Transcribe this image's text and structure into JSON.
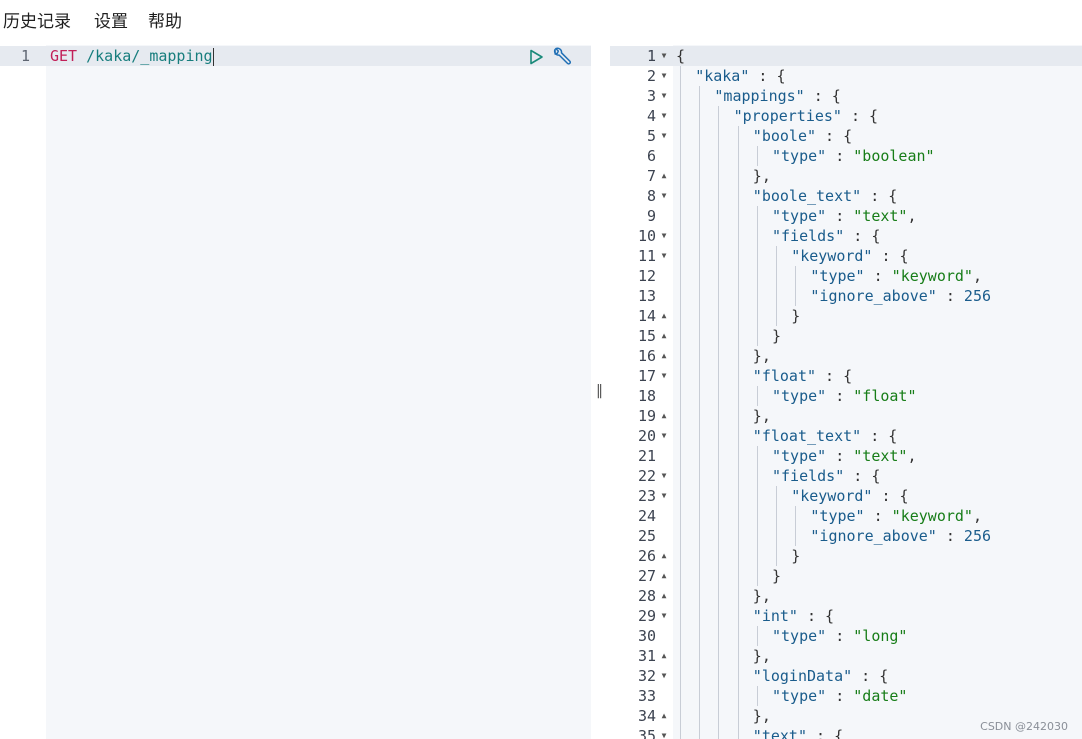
{
  "menu": {
    "history": "历史记录",
    "settings": "设置",
    "help": "帮助"
  },
  "request": {
    "line_number": "1",
    "method": "GET",
    "path": "/kaka/_mapping"
  },
  "icons": {
    "run": "play-icon",
    "settings": "wrench-icon",
    "divider": "resize-handle-icon"
  },
  "divider_label": "‖",
  "response_lines": [
    {
      "n": "1",
      "fold": "down",
      "indent": 0,
      "tokens": [
        [
          "p",
          "{"
        ]
      ]
    },
    {
      "n": "2",
      "fold": "down",
      "indent": 1,
      "tokens": [
        [
          "k",
          "\"kaka\""
        ],
        [
          "p",
          " : {"
        ]
      ]
    },
    {
      "n": "3",
      "fold": "down",
      "indent": 2,
      "tokens": [
        [
          "k",
          "\"mappings\""
        ],
        [
          "p",
          " : {"
        ]
      ]
    },
    {
      "n": "4",
      "fold": "down",
      "indent": 3,
      "tokens": [
        [
          "k",
          "\"properties\""
        ],
        [
          "p",
          " : {"
        ]
      ]
    },
    {
      "n": "5",
      "fold": "down",
      "indent": 4,
      "tokens": [
        [
          "k",
          "\"boole\""
        ],
        [
          "p",
          " : {"
        ]
      ]
    },
    {
      "n": "6",
      "fold": "",
      "indent": 5,
      "tokens": [
        [
          "k",
          "\"type\""
        ],
        [
          "p",
          " : "
        ],
        [
          "s",
          "\"boolean\""
        ]
      ]
    },
    {
      "n": "7",
      "fold": "up",
      "indent": 4,
      "tokens": [
        [
          "p",
          "},"
        ]
      ]
    },
    {
      "n": "8",
      "fold": "down",
      "indent": 4,
      "tokens": [
        [
          "k",
          "\"boole_text\""
        ],
        [
          "p",
          " : {"
        ]
      ]
    },
    {
      "n": "9",
      "fold": "",
      "indent": 5,
      "tokens": [
        [
          "k",
          "\"type\""
        ],
        [
          "p",
          " : "
        ],
        [
          "s",
          "\"text\""
        ],
        [
          "p",
          ","
        ]
      ]
    },
    {
      "n": "10",
      "fold": "down",
      "indent": 5,
      "tokens": [
        [
          "k",
          "\"fields\""
        ],
        [
          "p",
          " : {"
        ]
      ]
    },
    {
      "n": "11",
      "fold": "down",
      "indent": 6,
      "tokens": [
        [
          "k",
          "\"keyword\""
        ],
        [
          "p",
          " : {"
        ]
      ]
    },
    {
      "n": "12",
      "fold": "",
      "indent": 7,
      "tokens": [
        [
          "k",
          "\"type\""
        ],
        [
          "p",
          " : "
        ],
        [
          "s",
          "\"keyword\""
        ],
        [
          "p",
          ","
        ]
      ]
    },
    {
      "n": "13",
      "fold": "",
      "indent": 7,
      "tokens": [
        [
          "k",
          "\"ignore_above\""
        ],
        [
          "p",
          " : "
        ],
        [
          "n",
          "256"
        ]
      ]
    },
    {
      "n": "14",
      "fold": "up",
      "indent": 6,
      "tokens": [
        [
          "p",
          "}"
        ]
      ]
    },
    {
      "n": "15",
      "fold": "up",
      "indent": 5,
      "tokens": [
        [
          "p",
          "}"
        ]
      ]
    },
    {
      "n": "16",
      "fold": "up",
      "indent": 4,
      "tokens": [
        [
          "p",
          "},"
        ]
      ]
    },
    {
      "n": "17",
      "fold": "down",
      "indent": 4,
      "tokens": [
        [
          "k",
          "\"float\""
        ],
        [
          "p",
          " : {"
        ]
      ]
    },
    {
      "n": "18",
      "fold": "",
      "indent": 5,
      "tokens": [
        [
          "k",
          "\"type\""
        ],
        [
          "p",
          " : "
        ],
        [
          "s",
          "\"float\""
        ]
      ]
    },
    {
      "n": "19",
      "fold": "up",
      "indent": 4,
      "tokens": [
        [
          "p",
          "},"
        ]
      ]
    },
    {
      "n": "20",
      "fold": "down",
      "indent": 4,
      "tokens": [
        [
          "k",
          "\"float_text\""
        ],
        [
          "p",
          " : {"
        ]
      ]
    },
    {
      "n": "21",
      "fold": "",
      "indent": 5,
      "tokens": [
        [
          "k",
          "\"type\""
        ],
        [
          "p",
          " : "
        ],
        [
          "s",
          "\"text\""
        ],
        [
          "p",
          ","
        ]
      ]
    },
    {
      "n": "22",
      "fold": "down",
      "indent": 5,
      "tokens": [
        [
          "k",
          "\"fields\""
        ],
        [
          "p",
          " : {"
        ]
      ]
    },
    {
      "n": "23",
      "fold": "down",
      "indent": 6,
      "tokens": [
        [
          "k",
          "\"keyword\""
        ],
        [
          "p",
          " : {"
        ]
      ]
    },
    {
      "n": "24",
      "fold": "",
      "indent": 7,
      "tokens": [
        [
          "k",
          "\"type\""
        ],
        [
          "p",
          " : "
        ],
        [
          "s",
          "\"keyword\""
        ],
        [
          "p",
          ","
        ]
      ]
    },
    {
      "n": "25",
      "fold": "",
      "indent": 7,
      "tokens": [
        [
          "k",
          "\"ignore_above\""
        ],
        [
          "p",
          " : "
        ],
        [
          "n",
          "256"
        ]
      ]
    },
    {
      "n": "26",
      "fold": "up",
      "indent": 6,
      "tokens": [
        [
          "p",
          "}"
        ]
      ]
    },
    {
      "n": "27",
      "fold": "up",
      "indent": 5,
      "tokens": [
        [
          "p",
          "}"
        ]
      ]
    },
    {
      "n": "28",
      "fold": "up",
      "indent": 4,
      "tokens": [
        [
          "p",
          "},"
        ]
      ]
    },
    {
      "n": "29",
      "fold": "down",
      "indent": 4,
      "tokens": [
        [
          "k",
          "\"int\""
        ],
        [
          "p",
          " : {"
        ]
      ]
    },
    {
      "n": "30",
      "fold": "",
      "indent": 5,
      "tokens": [
        [
          "k",
          "\"type\""
        ],
        [
          "p",
          " : "
        ],
        [
          "s",
          "\"long\""
        ]
      ]
    },
    {
      "n": "31",
      "fold": "up",
      "indent": 4,
      "tokens": [
        [
          "p",
          "},"
        ]
      ]
    },
    {
      "n": "32",
      "fold": "down",
      "indent": 4,
      "tokens": [
        [
          "k",
          "\"loginData\""
        ],
        [
          "p",
          " : {"
        ]
      ]
    },
    {
      "n": "33",
      "fold": "",
      "indent": 5,
      "tokens": [
        [
          "k",
          "\"type\""
        ],
        [
          "p",
          " : "
        ],
        [
          "s",
          "\"date\""
        ]
      ]
    },
    {
      "n": "34",
      "fold": "up",
      "indent": 4,
      "tokens": [
        [
          "p",
          "},"
        ]
      ]
    },
    {
      "n": "35",
      "fold": "down",
      "indent": 4,
      "tokens": [
        [
          "k",
          "\"text\""
        ],
        [
          "p",
          " : {"
        ]
      ]
    }
  ],
  "watermark": "CSDN @242030",
  "colors": {
    "method": "#c21f58",
    "path": "#177d7d",
    "key": "#1a5c8c",
    "string": "#177d18",
    "active_line": "#e6eaf0",
    "editor_bg": "#f5f7fa"
  }
}
